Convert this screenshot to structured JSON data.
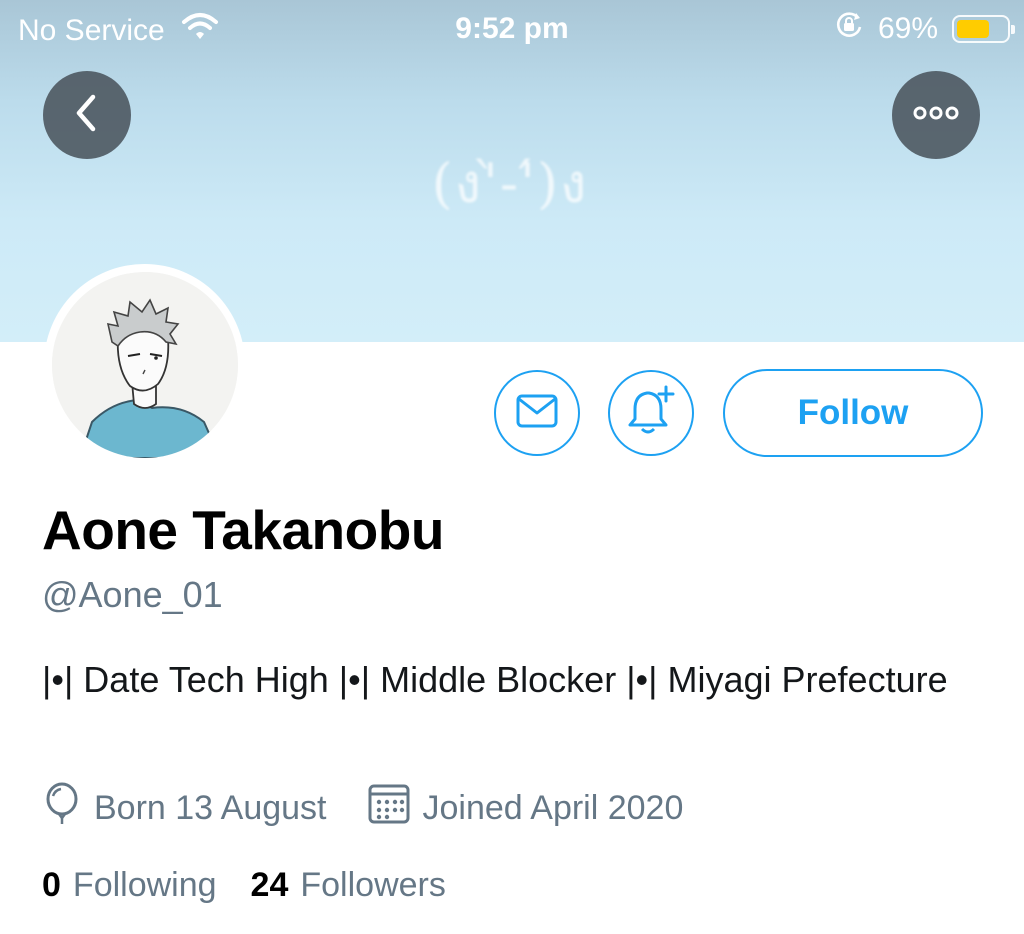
{
  "status_bar": {
    "carrier": "No Service",
    "time": "9:52 pm",
    "battery_percent": "69%",
    "battery_level": 0.69,
    "battery_color": "#ffcc00"
  },
  "header": {
    "watermark_text": "(ง'̀-'́)ง",
    "back_icon": "chevron-left-icon",
    "more_icon": "more-horizontal-icon"
  },
  "actions": {
    "message_icon": "envelope-icon",
    "notify_icon": "bell-plus-icon",
    "follow_label": "Follow",
    "accent_color": "#1da1f2"
  },
  "profile": {
    "name": "Aone Takanobu",
    "handle": "@Aone_01",
    "bio": "|•| Date Tech High |•| Middle Blocker |•| Miyagi Prefecture",
    "birthday": "Born 13 August",
    "joined": "Joined April 2020",
    "following_count": "0",
    "following_label": "Following",
    "followers_count": "24",
    "followers_label": "Followers"
  }
}
